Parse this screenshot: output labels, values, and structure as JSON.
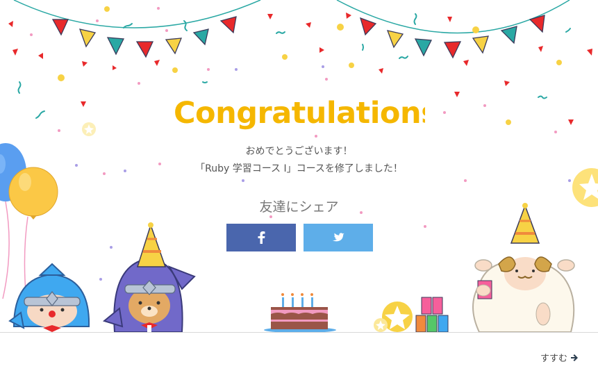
{
  "modal": {
    "title": "Congratulations",
    "message_line1": "おめでとうございます！",
    "message_line2": "「Ruby 学習コース I」コースを修了しました！",
    "share_label": "友達にシェア",
    "share_buttons": [
      {
        "service": "facebook",
        "icon": "facebook-icon",
        "color": "#4a66ad"
      },
      {
        "service": "twitter",
        "icon": "twitter-icon",
        "color": "#5eaee9"
      }
    ]
  },
  "footer": {
    "next_label": "すすむ",
    "next_icon": "arrow-right-icon"
  },
  "colors": {
    "title": "#f5b700",
    "flag_red": "#e8292b",
    "flag_yellow": "#f7d245",
    "flag_teal": "#2aa8a4",
    "balloon_blue": "#5a9ef0",
    "balloon_yellow": "#fbc846"
  }
}
